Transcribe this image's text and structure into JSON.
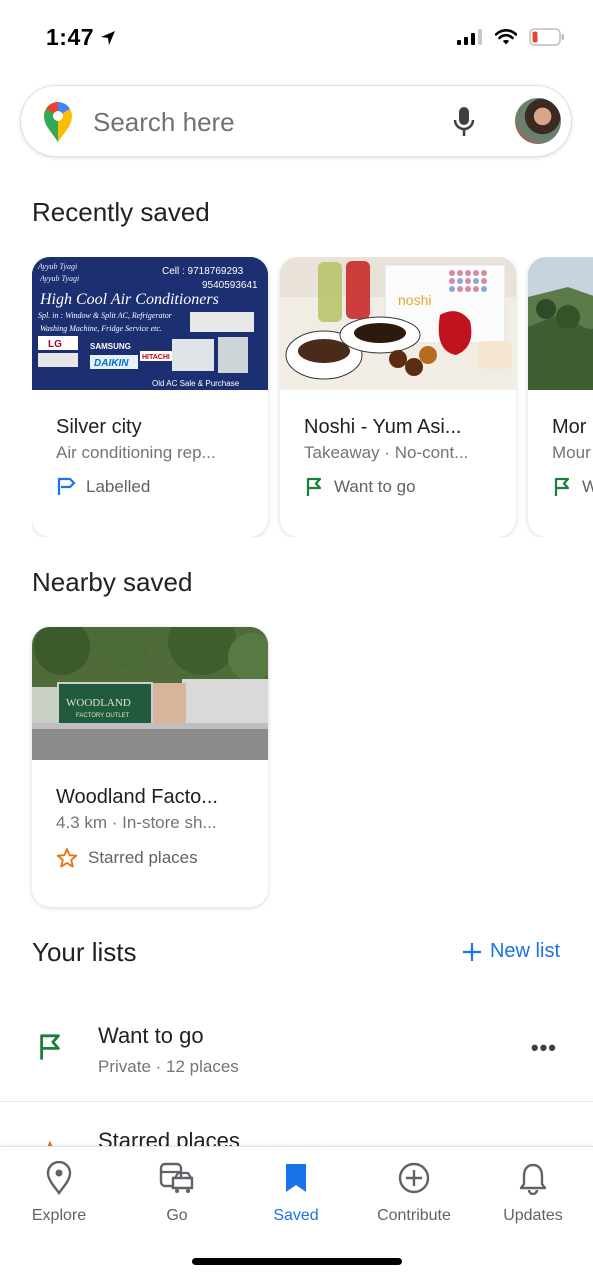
{
  "status": {
    "time": "1:47"
  },
  "search": {
    "placeholder": "Search here"
  },
  "sections": {
    "recently_saved": "Recently saved",
    "nearby_saved": "Nearby saved",
    "your_lists": "Your lists",
    "new_list": "New list"
  },
  "recent_cards": [
    {
      "name": "Silver city",
      "subtitle": "Air conditioning rep...",
      "list": "Labelled",
      "list_icon": "label-icon",
      "sign": {
        "top_left": "Ayyub Tyagi",
        "phone1": "Cell : 9718769293",
        "phone2": "9540593641",
        "title": "High Cool Air Conditioners",
        "line1": "Spl. in : Window & Split AC, Refrigerator",
        "line2": "Washing Machine, Fridge Service etc.",
        "brands": [
          "LG",
          "SAMSUNG",
          "DAIKIN",
          "HITACHI"
        ],
        "bottom": "Old AC Sale & Purchase"
      }
    },
    {
      "name": "Noshi - Yum Asi...",
      "subtitle": "Takeaway · No-cont...",
      "list": "Want to go",
      "list_icon": "flag-icon",
      "brand": "noshi"
    },
    {
      "name": "Mor",
      "subtitle": "Mour",
      "list": "W",
      "list_icon": "flag-icon"
    }
  ],
  "nearby_cards": [
    {
      "name": "Woodland Facto...",
      "subtitle": "4.3 km · In-store sh...",
      "list": "Starred places",
      "list_icon": "star-icon",
      "sign": {
        "title": "WOODLAND",
        "line": "FACTORY OUTLET"
      }
    }
  ],
  "lists": [
    {
      "name": "Want to go",
      "subtitle": "Private · 12 places",
      "icon": "flag-icon"
    },
    {
      "name": "Starred places",
      "icon": "star-icon"
    }
  ],
  "nav": [
    {
      "label": "Explore",
      "icon": "location-pin-icon",
      "active": false
    },
    {
      "label": "Go",
      "icon": "commute-icon",
      "active": false
    },
    {
      "label": "Saved",
      "icon": "bookmark-icon",
      "active": true
    },
    {
      "label": "Contribute",
      "icon": "add-circle-icon",
      "active": false
    },
    {
      "label": "Updates",
      "icon": "bell-icon",
      "active": false
    }
  ],
  "colors": {
    "accent": "#1a73e8",
    "flag_green": "#188038",
    "star_orange": "#e8710a",
    "label_blue": "#1a73e8",
    "battery_red": "#ea4335"
  }
}
